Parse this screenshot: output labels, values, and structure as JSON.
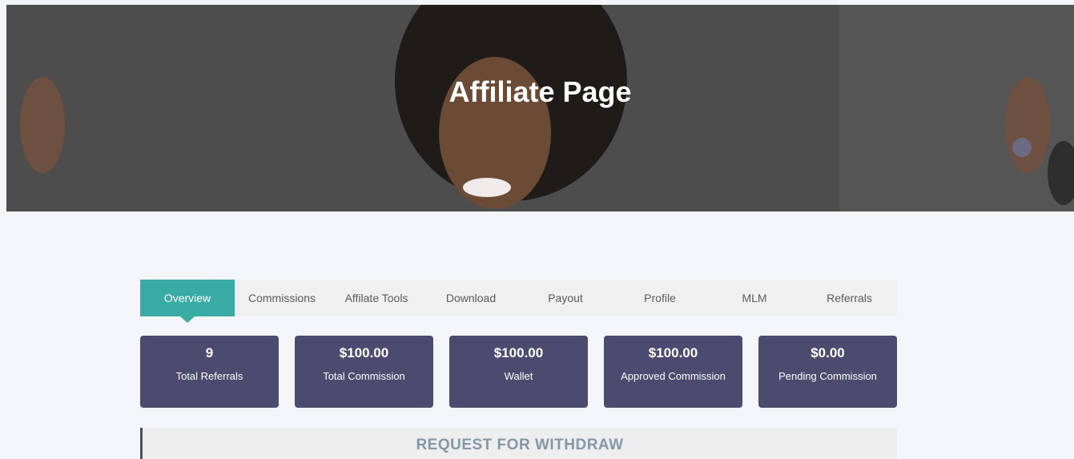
{
  "hero": {
    "title": "Affiliate Page"
  },
  "tabs": [
    {
      "label": "Overview",
      "active": true
    },
    {
      "label": "Commissions",
      "active": false
    },
    {
      "label": "Affilate Tools",
      "active": false
    },
    {
      "label": "Download",
      "active": false
    },
    {
      "label": "Payout",
      "active": false
    },
    {
      "label": "Profile",
      "active": false
    },
    {
      "label": "MLM",
      "active": false
    },
    {
      "label": "Referrals",
      "active": false
    }
  ],
  "stats": [
    {
      "value": "9",
      "label": "Total Referrals"
    },
    {
      "value": "$100.00",
      "label": "Total Commission"
    },
    {
      "value": "$100.00",
      "label": "Wallet"
    },
    {
      "value": "$100.00",
      "label": "Approved Commission"
    },
    {
      "value": "$0.00",
      "label": "Pending Commission"
    }
  ],
  "withdraw": {
    "title": "REQUEST FOR WITHDRAW"
  },
  "colors": {
    "accent": "#39aba5",
    "card": "#4c4a6e",
    "background": "#f4f5f9"
  }
}
